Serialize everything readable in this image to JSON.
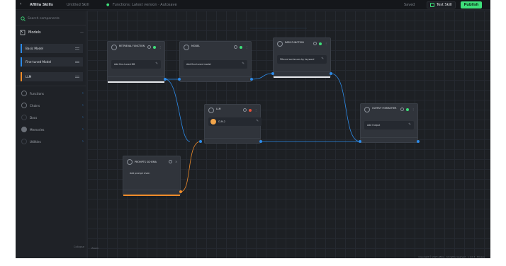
{
  "topbar": {
    "app_title": "Afiliia Skills",
    "workspace": "Untitled Skill",
    "status": "Functions: Latest version · Autosave",
    "test_button": "Test Skill",
    "publish_button": "Publish",
    "saved_label": "Saved"
  },
  "sidebar": {
    "search_placeholder": "Search components",
    "models_header": "Models",
    "model_items": [
      {
        "label": "Basic Model"
      },
      {
        "label": "Fine-tuned Model"
      },
      {
        "label": "LLM"
      }
    ],
    "categories": [
      {
        "label": "Functions"
      },
      {
        "label": "Chains"
      },
      {
        "label": "Docs"
      },
      {
        "label": "Memories"
      },
      {
        "label": "Utilities"
      }
    ],
    "collapse_label": "Collapse"
  },
  "canvas": {
    "zoom": "Zoom",
    "footer": "Copyright © 2023 Afiliia · All rights reserved · v 1.0.7 · Privacy",
    "nodes": {
      "retrieval": {
        "title": "RETRIEVAL FUNCTION",
        "field": "Add fine-tuned DB"
      },
      "model": {
        "title": "MODEL",
        "field": "Add fine-tuned model"
      },
      "data_function": {
        "title": "DATA FUNCTION",
        "field": "Filtered sentences by keyword"
      },
      "llm": {
        "title": "LLM",
        "field": "CLM-2"
      },
      "output": {
        "title": "OUTPUT FORMATTER",
        "field": "Add Output"
      },
      "prompt": {
        "title": "PROMPTS SCHEMA",
        "field": "Add prompt chain"
      }
    }
  },
  "colors": {
    "accent_green": "#3ee07a",
    "accent_blue": "#2d8be8",
    "accent_orange": "#f08c2a",
    "background": "#1c1f24"
  }
}
